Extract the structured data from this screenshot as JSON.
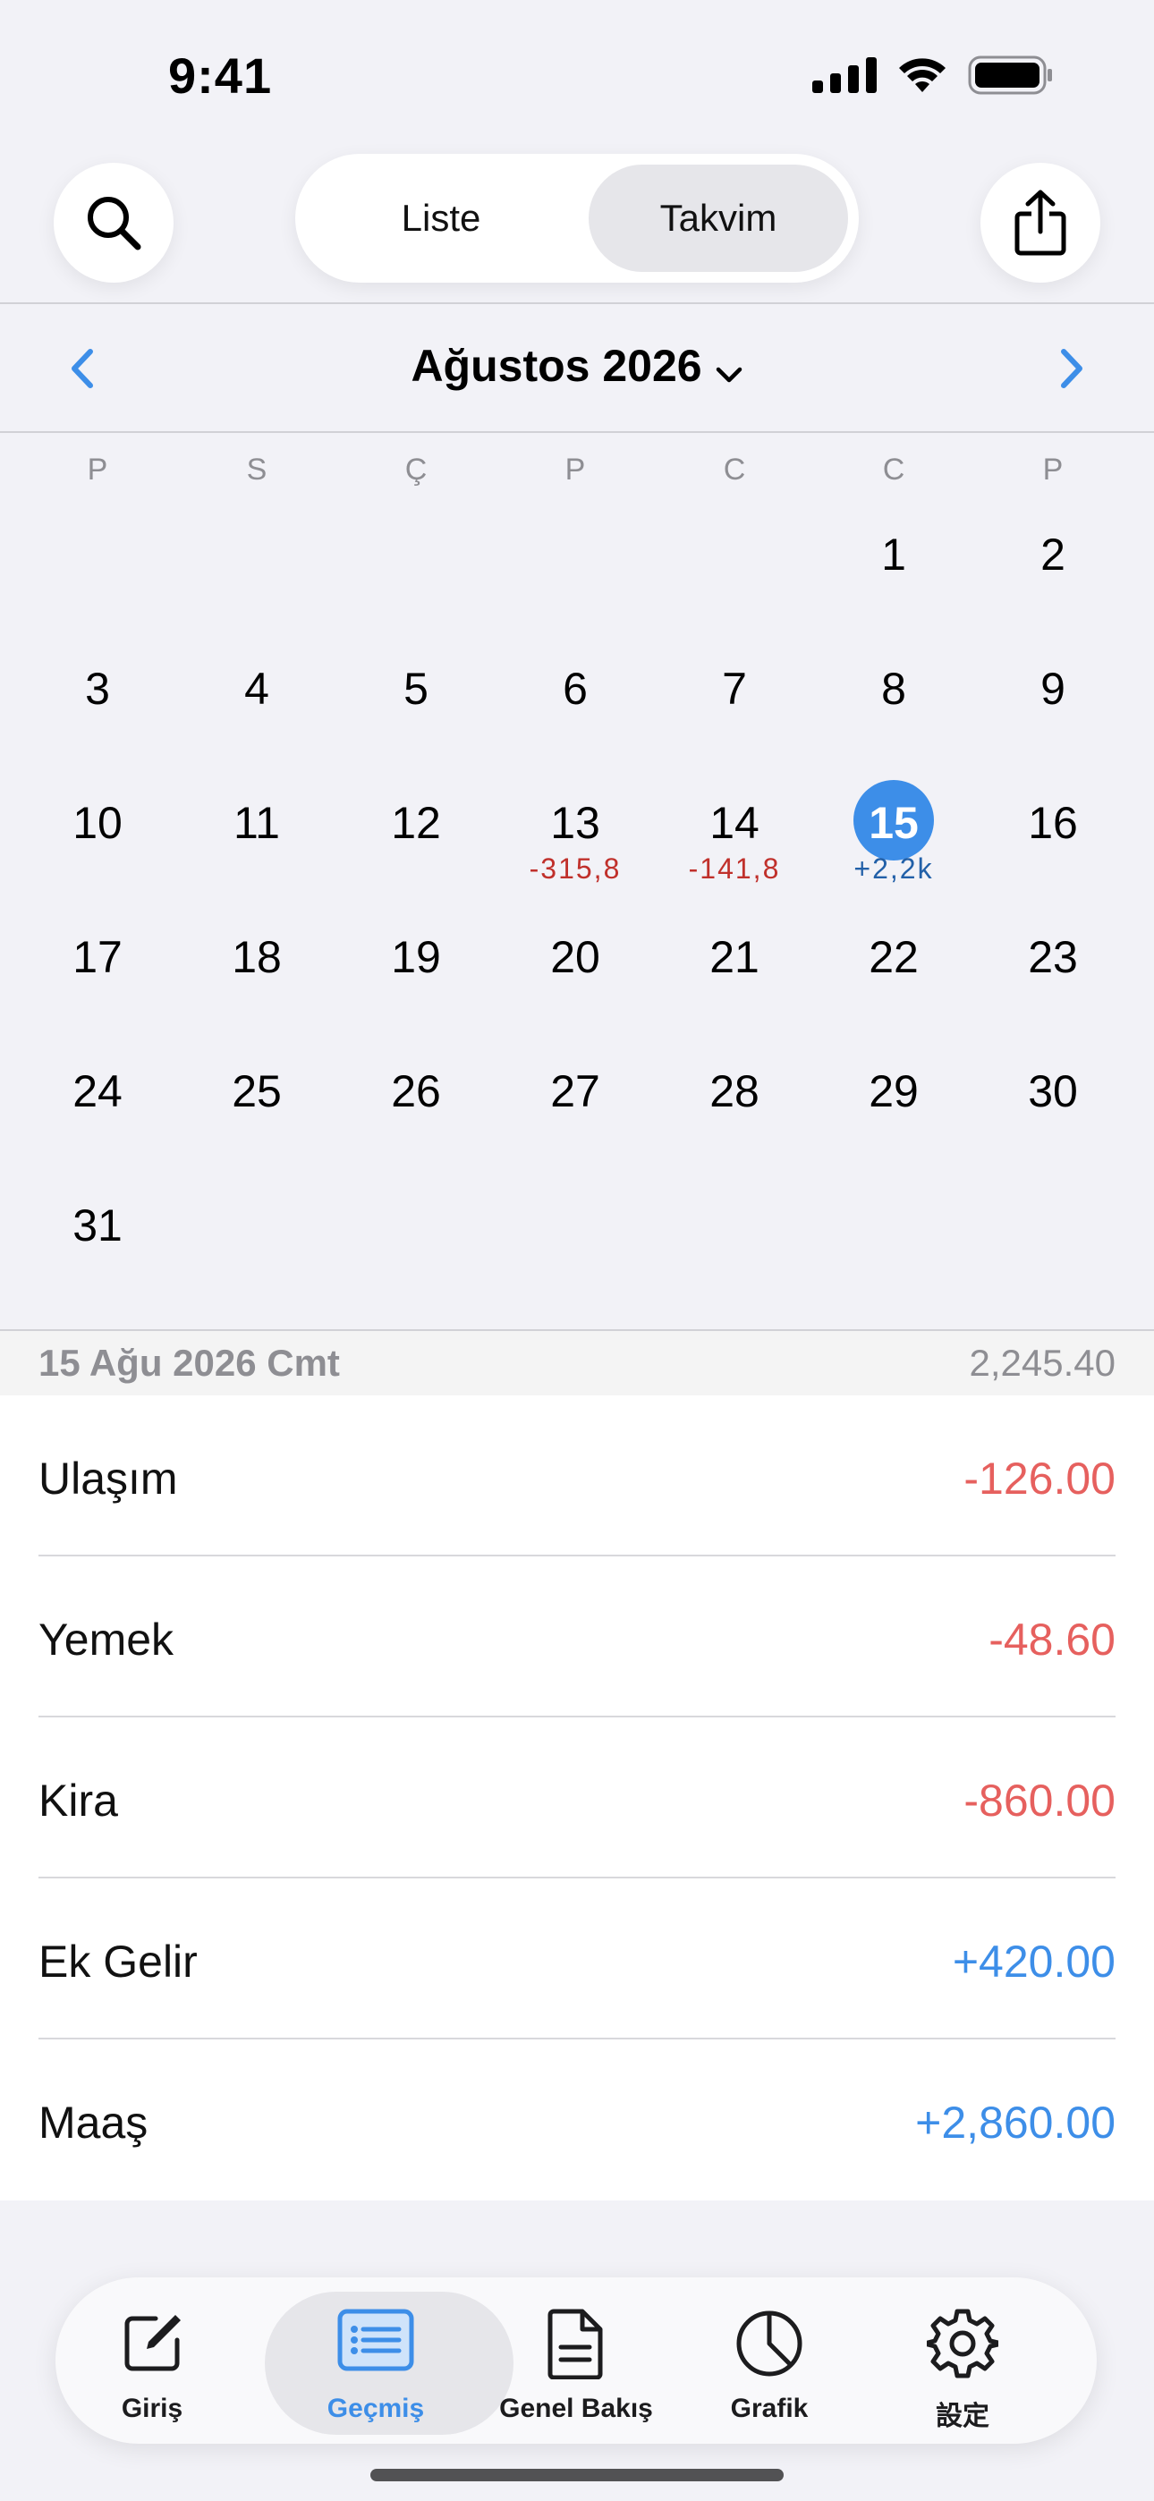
{
  "status_bar": {
    "time": "9:41"
  },
  "top_bar": {
    "search_icon": "search-icon",
    "share_icon": "share-icon",
    "segments": [
      {
        "label": "Liste",
        "active": false
      },
      {
        "label": "Takvim",
        "active": true
      }
    ]
  },
  "month_nav": {
    "title": "Ağustos 2026"
  },
  "calendar": {
    "weekdays": [
      "P",
      "S",
      "Ç",
      "P",
      "C",
      "C",
      "P"
    ],
    "weeks": [
      [
        "",
        "",
        "",
        "",
        "",
        "1",
        "2"
      ],
      [
        "3",
        "4",
        "5",
        "6",
        "7",
        "8",
        "9"
      ],
      [
        "10",
        "11",
        "12",
        "13",
        "14",
        "15",
        "16"
      ],
      [
        "17",
        "18",
        "19",
        "20",
        "21",
        "22",
        "23"
      ],
      [
        "24",
        "25",
        "26",
        "27",
        "28",
        "29",
        "30"
      ],
      [
        "31",
        "",
        "",
        "",
        "",
        "",
        ""
      ]
    ],
    "selected_day": "15",
    "day_amounts": [
      {
        "day": "13",
        "amount": "-315,8",
        "sign": "neg"
      },
      {
        "day": "14",
        "amount": "-141,8",
        "sign": "neg"
      },
      {
        "day": "15",
        "amount": "+2,2k",
        "sign": "pos"
      }
    ]
  },
  "day_detail": {
    "date": "15 Ağu 2026 Cmt",
    "total": "2,245.40",
    "transactions": [
      {
        "label": "Ulaşım",
        "amount": "-126.00",
        "sign": "neg"
      },
      {
        "label": "Yemek",
        "amount": "-48.60",
        "sign": "neg"
      },
      {
        "label": "Kira",
        "amount": "-860.00",
        "sign": "neg"
      },
      {
        "label": "Ek Gelir",
        "amount": "+420.00",
        "sign": "pos"
      },
      {
        "label": "Maaş",
        "amount": "+2,860.00",
        "sign": "pos"
      }
    ]
  },
  "tab_bar": {
    "tabs": [
      {
        "label": "Giriş",
        "icon": "compose-icon",
        "active": false
      },
      {
        "label": "Geçmiş",
        "icon": "list-icon",
        "active": true
      },
      {
        "label": "Genel Bakış",
        "icon": "document-icon",
        "active": false
      },
      {
        "label": "Grafik",
        "icon": "pie-chart-icon",
        "active": false
      },
      {
        "label": "設定",
        "icon": "gear-icon",
        "active": false
      }
    ]
  },
  "colors": {
    "accent": "#3d8ee8",
    "negative": "#e6605e",
    "negative_small": "#c0302b",
    "positive_small": "#2260a8"
  }
}
